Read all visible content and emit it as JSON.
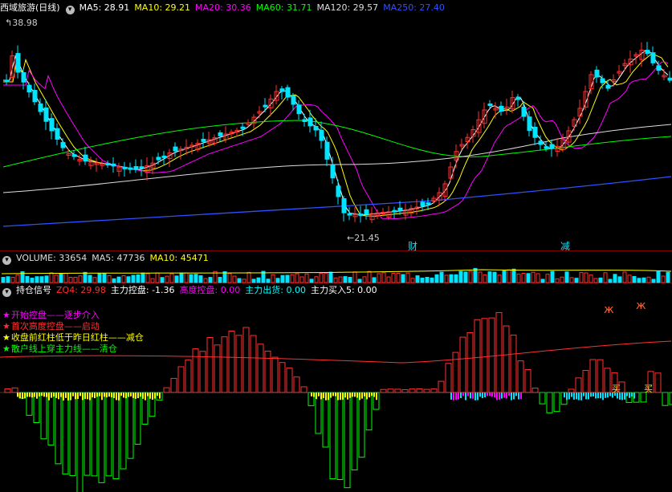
{
  "main": {
    "title": "西域旅游(日线)",
    "indicators": [
      {
        "label": "MA5: 28.91",
        "color": "#ffffff"
      },
      {
        "label": "MA10: 29.21",
        "color": "#ffff00"
      },
      {
        "label": "MA20: 30.36",
        "color": "#ff00ff"
      },
      {
        "label": "MA60: 31.71",
        "color": "#00ff00"
      },
      {
        "label": "MA120: 29.57",
        "color": "#dddddd"
      },
      {
        "label": "MA250: 27.40",
        "color": "#3050ff"
      }
    ],
    "high_label": "38.98",
    "low_label": "21.45",
    "mark_cai": "财",
    "mark_jian": "减"
  },
  "volume": {
    "indicators": [
      {
        "label": "VOLUME: 33654",
        "color": "#dddddd"
      },
      {
        "label": "MA5: 47736",
        "color": "#dddddd"
      },
      {
        "label": "MA10: 45471",
        "color": "#ffff00"
      }
    ]
  },
  "signal": {
    "title": "持仓信号",
    "indicators": [
      {
        "label": "ZQ4: 29.98",
        "color": "#ff3030"
      },
      {
        "label": "主力控盘: -1.36",
        "color": "#ffffff"
      },
      {
        "label": "高度控盘: 0.00",
        "color": "#ff00ff"
      },
      {
        "label": "主力出货: 0.00",
        "color": "#00ffff"
      },
      {
        "label": "主力买入5: 0.00",
        "color": "#ffffff"
      }
    ],
    "legend": [
      {
        "text": "开始控盘——逐步介入",
        "color": "#ff00ff"
      },
      {
        "text": "首次高度控盘——启动",
        "color": "#ff3030"
      },
      {
        "text": "收盘前红柱低于昨日红柱——减仓",
        "color": "#ffff00"
      },
      {
        "text": "散户线上穿主力线——清仓",
        "color": "#00ff00"
      }
    ],
    "mark_buy1": "买",
    "mark_buy2": "买"
  },
  "colors": {
    "up": "#ff3030",
    "down": "#00e5ff",
    "ma5": "#ffffff",
    "ma10": "#ffff00",
    "ma20": "#ff00ff",
    "ma60": "#00ff00",
    "ma120": "#dddddd",
    "ma250": "#3050ff"
  }
}
